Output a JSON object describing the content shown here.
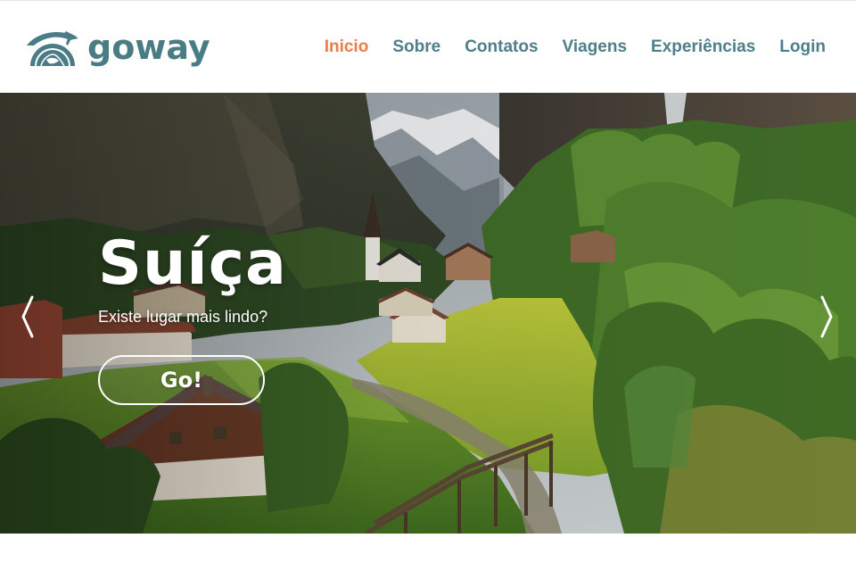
{
  "brand": {
    "name": "goway",
    "logo_icon": "globe-airplane-icon",
    "color": "#4a7c86"
  },
  "nav": {
    "items": [
      {
        "label": "Inicio",
        "active": true
      },
      {
        "label": "Sobre",
        "active": false
      },
      {
        "label": "Contatos",
        "active": false
      },
      {
        "label": "Viagens",
        "active": false
      },
      {
        "label": "Experiências",
        "active": false
      },
      {
        "label": "Login",
        "active": false
      }
    ],
    "color": "#4d7f89",
    "active_color": "#ec7d44"
  },
  "hero": {
    "title": "Suíça",
    "subtitle": "Existe lugar mais lindo?",
    "button_label": "Go!",
    "prev_icon": "chevron-left-icon",
    "next_icon": "chevron-right-icon"
  }
}
